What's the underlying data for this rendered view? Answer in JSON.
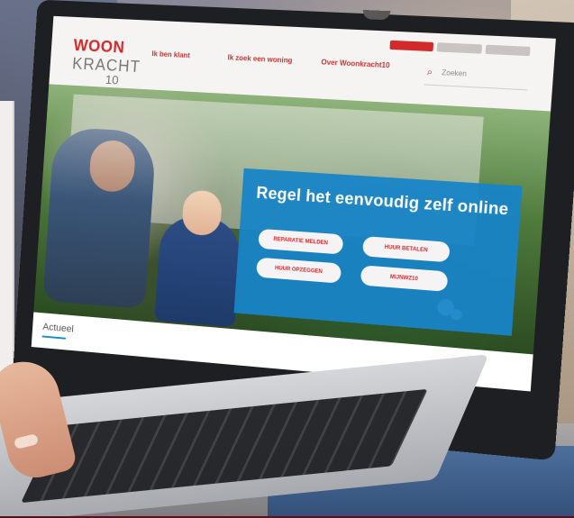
{
  "site": {
    "logo": {
      "line1": "WOON",
      "line2": "KRACHT",
      "line3": "10"
    },
    "nav": [
      {
        "label": "Ik ben\nklant"
      },
      {
        "label": "Ik zoek\neen woning"
      },
      {
        "label": "Over\nWoonkracht10"
      }
    ],
    "search_placeholder": "Zoeken",
    "hero": {
      "title": "Regel het eenvoudig zelf online",
      "buttons": [
        {
          "label": "REPARATIE MELDEN"
        },
        {
          "label": "HUUR BETALEN"
        },
        {
          "label": "HUUR OPZEGGEN"
        },
        {
          "label": "MIJNWZ10"
        }
      ]
    },
    "section": {
      "label": "Actueel"
    }
  },
  "colors": {
    "brand_red": "#d22a2b",
    "promo_blue": "#1784c8"
  }
}
